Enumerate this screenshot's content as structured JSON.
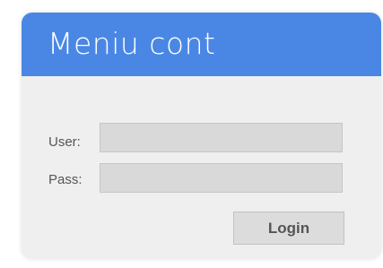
{
  "login_panel": {
    "title": "Meniu cont",
    "user_label": "User:",
    "user_value": "",
    "pass_label": "Pass:",
    "pass_value": "",
    "login_button": "Login",
    "colors": {
      "header": "#4a87e5",
      "panel_background": "#efefef",
      "input_background": "#d9d9d9",
      "button_background": "#dcdcdc"
    }
  }
}
